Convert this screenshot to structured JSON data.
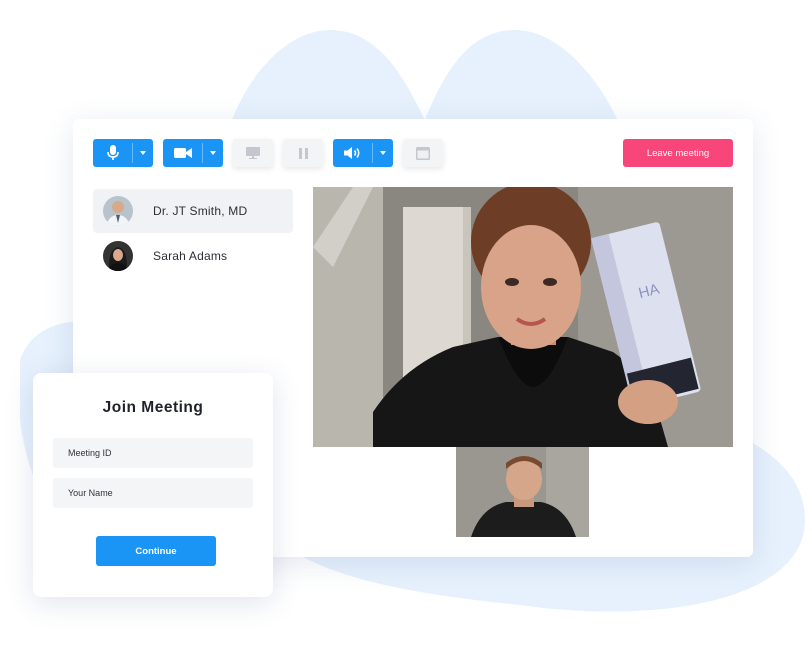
{
  "colors": {
    "primary": "#1a95f5",
    "danger": "#f8467b",
    "blob": "#e7f1fd",
    "panel_active": "#f0f2f5"
  },
  "toolbar": {
    "mic": {
      "icon": "microphone-icon",
      "dropdown_icon": "caret-down-icon"
    },
    "camera": {
      "icon": "video-camera-icon",
      "dropdown_icon": "caret-down-icon"
    },
    "screen_share": {
      "icon": "monitor-icon"
    },
    "pause": {
      "icon": "pause-icon"
    },
    "speaker": {
      "icon": "speaker-volume-icon",
      "dropdown_icon": "caret-down-icon"
    },
    "window": {
      "icon": "window-icon"
    },
    "leave_label": "Leave meeting"
  },
  "participants": [
    {
      "name": "Dr. JT Smith, MD",
      "active": true
    },
    {
      "name": "Sarah Adams",
      "active": false
    }
  ],
  "join": {
    "title": "Join Meeting",
    "meeting_id_placeholder": "Meeting ID",
    "name_placeholder": "Your Name",
    "continue_label": "Continue"
  }
}
